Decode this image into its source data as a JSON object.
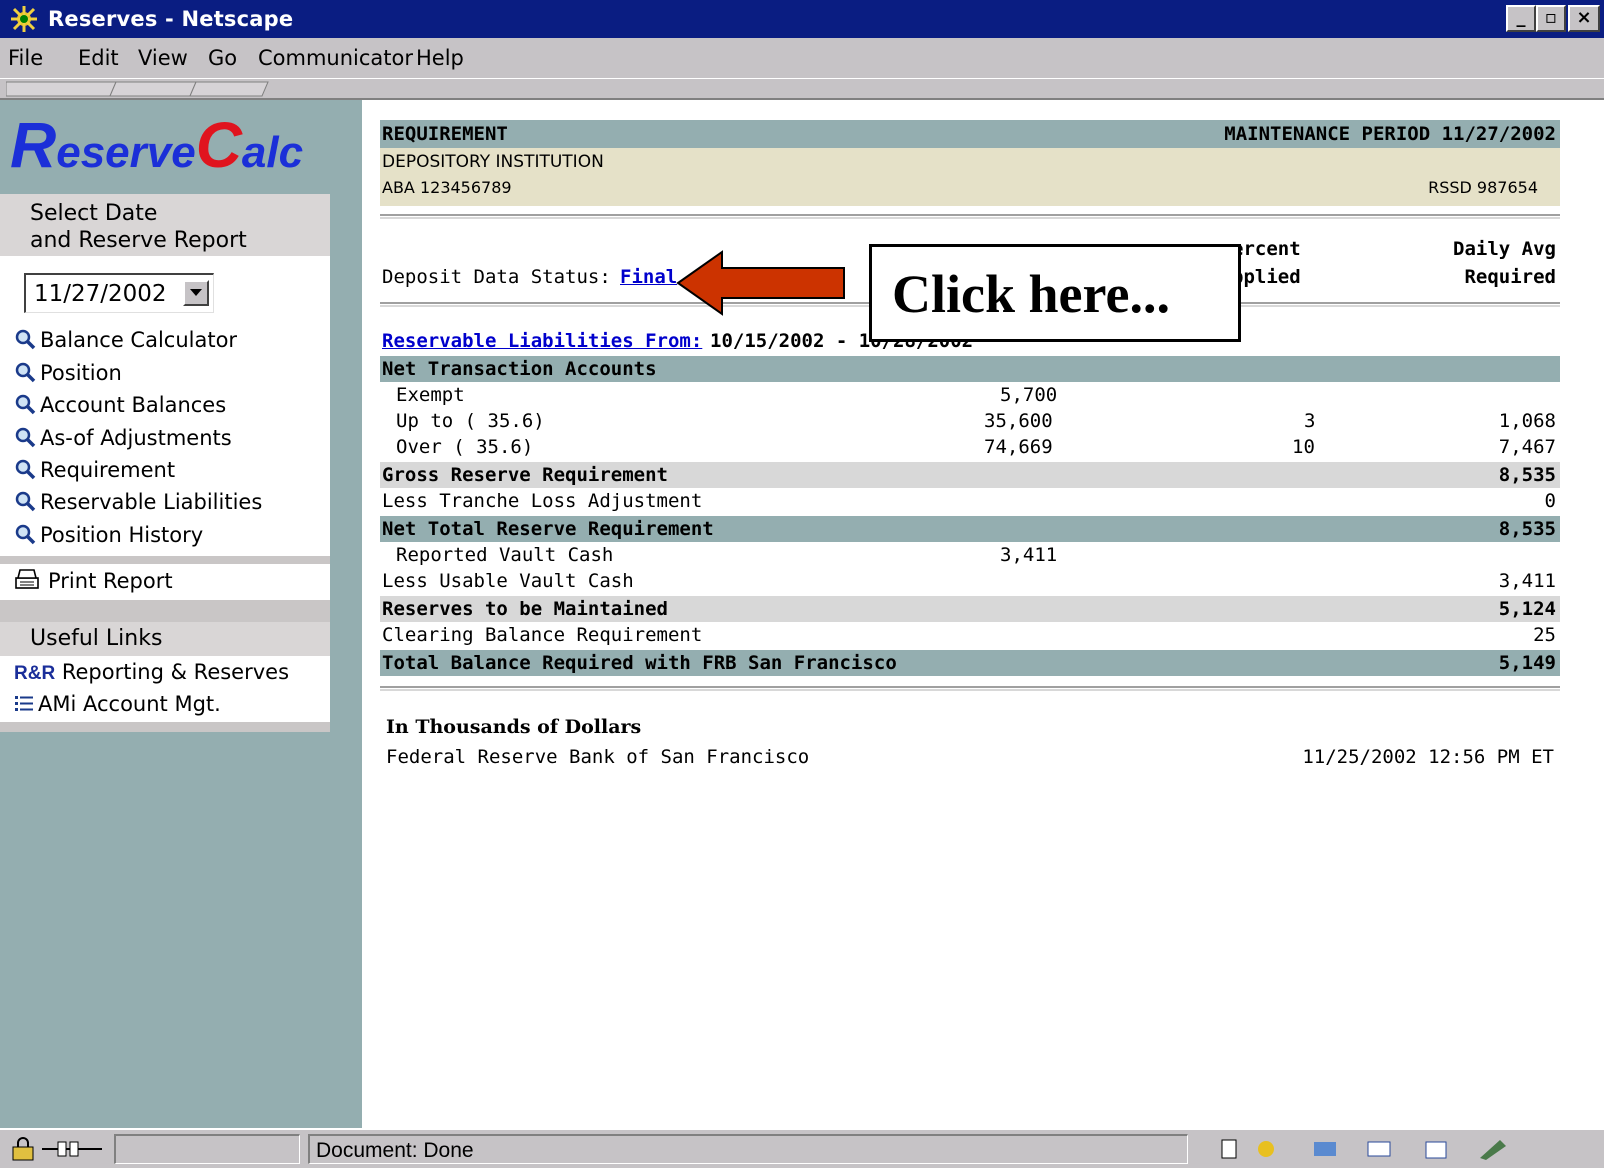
{
  "window": {
    "title": "Reserves - Netscape"
  },
  "menu": [
    "File",
    "Edit",
    "View",
    "Go",
    "Communicator",
    "Help"
  ],
  "sidebar": {
    "logo_r": "R",
    "logo_eserve": "eserve",
    "logo_c": "C",
    "logo_alc": "alc",
    "select_heading_1": "Select Date",
    "select_heading_2": "and Reserve Report",
    "date_value": "11/27/2002",
    "nav": [
      "Balance Calculator",
      "Position",
      "Account Balances",
      "As-of Adjustments",
      "Requirement",
      "Reservable Liabilities",
      "Position History"
    ],
    "print_label": "Print Report",
    "useful_links_heading": "Useful Links",
    "rr_badge": "R&R",
    "rr_label": "Reporting & Reserves",
    "ami_label": "AMi Account Mgt."
  },
  "report": {
    "title_left": "REQUIREMENT",
    "title_right": "MAINTENANCE PERIOD 11/27/2002",
    "institution": "DEPOSITORY INSTITUTION",
    "aba": "ABA 123456789",
    "rssd": "RSSD 987654",
    "col_percent_1": "ercent",
    "col_percent_2": "pplied",
    "col_daily_1": "Daily Avg",
    "col_daily_2": "Required",
    "status_label": "Deposit Data Status:",
    "status_link": "Final",
    "liab_link": "Reservable Liabilities From:",
    "liab_range": "10/15/2002 - 10/28/2002",
    "net_transaction": "Net Transaction Accounts",
    "rows": {
      "exempt": {
        "label": "Exempt",
        "amount": "5,700"
      },
      "upto": {
        "label": "Up to ( 35.6)",
        "amount": "35,600",
        "percent": "3",
        "required": "1,068"
      },
      "over": {
        "label": "Over  ( 35.6)",
        "amount": "74,669",
        "percent": "10",
        "required": "7,467"
      },
      "gross": {
        "label": "Gross Reserve Requirement",
        "required": "8,535"
      },
      "tranche": {
        "label": "Less Tranche Loss Adjustment",
        "required": "0"
      },
      "net_total": {
        "label": "Net Total Reserve Requirement",
        "required": "8,535"
      },
      "vault_reported": {
        "label": "Reported Vault Cash",
        "amount": "3,411"
      },
      "usable_vault": {
        "label": "Less Usable Vault Cash",
        "required": "3,411"
      },
      "to_maintain": {
        "label": "Reserves to be Maintained",
        "required": "5,124"
      },
      "clearing": {
        "label": "Clearing Balance Requirement",
        "required": "25"
      },
      "total": {
        "label": "Total Balance Required with FRB San Francisco",
        "required": "5,149"
      }
    },
    "footer_units": "In Thousands of Dollars",
    "footer_bank": "Federal Reserve Bank of San Francisco",
    "footer_timestamp": "11/25/2002 12:56 PM ET"
  },
  "callout": {
    "text": "Click here..."
  },
  "statusbar": {
    "text": "Document: Done"
  },
  "colors": {
    "teal": "#94aeb0",
    "beige": "#e5e1c8",
    "arrow": "#cc3300",
    "link": "#0000cc"
  }
}
